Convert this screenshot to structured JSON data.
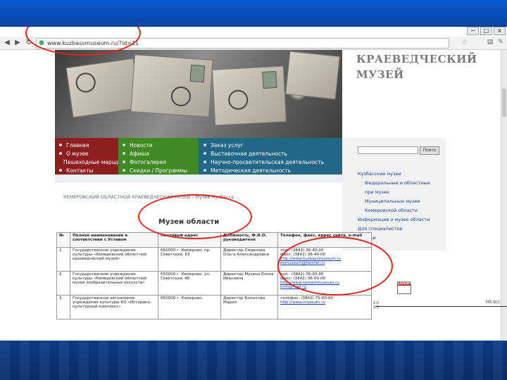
{
  "browser": {
    "url": "www.kuzbassmuseum.ru/?id=11",
    "window_controls": [
      "−",
      "□",
      "×"
    ],
    "nav_icons": [
      "back-icon",
      "forward-icon",
      "reload-icon"
    ],
    "toolbar_icons": [
      "page-icon",
      "wrench-icon"
    ]
  },
  "site": {
    "title_line1": "КРАЕВЕДЧЕСКИЙ",
    "title_line2": "МУЗЕЙ"
  },
  "menu": {
    "red": [
      "Главная",
      "О музее",
      "Пешеходные маршруты",
      "Контакты"
    ],
    "green": [
      "Новости",
      "Афиша",
      "Фотогалерея",
      "Скидки / Программы"
    ],
    "blue": [
      "Заказ услуг",
      "Выставочная деятельность",
      "Научно-просветительская деятельность",
      "Методическая деятельность"
    ]
  },
  "search": {
    "button": "Поиск"
  },
  "sidebar": {
    "links": [
      "Кузбасские музеи",
      "Федеральные и областные",
      "при музее",
      "Муниципальные музеи",
      "Кемеровской области",
      "Информация о музее области",
      "Для специалистов",
      "Ссылки"
    ]
  },
  "subtitle": "КЕМЕРОВСКИЙ ОБЛАСТНОЙ КРАЕВЕДЧЕСКИЙ МУЗЕЙ – Музеи Кузбасса",
  "heading": "Музеи области",
  "table": {
    "headers": [
      "№",
      "Полное наименование в соответствии с Уставом",
      "Почтовый адрес",
      "Должность, Ф.И.О. руководителя",
      "Телефон, факс, адрес сайта, e-mail"
    ],
    "rows": [
      {
        "num": "1.",
        "name": "Государственное учреждение культуры «Кемеровский областной краеведческий музей»",
        "address": "650000 г. Кемерово, пр. Советский, 63",
        "head": "Директор Смирнова Ольга Александровна",
        "phone": "тел.: (3842) 36-40-00",
        "fax": "факс: (3842) 36-40-00",
        "site": "http://www.kuzbassmuseum.ru",
        "email": "komuseum@kemtel.ru"
      },
      {
        "num": "2.",
        "name": "Государственное учреждение культуры «Кемеровский областной музей изобразительных искусств»",
        "address": "650000 г. Кемерово, ул. Советская, 48",
        "head": "Директор Мусина Елена Ивановна",
        "phone": "тел.: (3842) 36-00-00",
        "fax": "факс: (3842) 36-00-00",
        "site": "http://www.kemartmuseum.ru",
        "email": "kmii@mail.ru"
      },
      {
        "num": "3.",
        "name": "Государственное автономное учреждение культуры КО «Историко-культурный комплекс»",
        "address": "650000 г. Кемерово,",
        "head": "Директор Копытова Мария",
        "phone": "телефон: (3842) 75-00-00",
        "fax": "",
        "site": "http://www.museum.ru",
        "email": ""
      }
    ]
  },
  "counter": {
    "label": "LIVEINTERNET",
    "values": [
      "2.0",
      "1.5"
    ]
  },
  "right_label": "Hit-tcc",
  "colors": {
    "menu_red": "#8e1f21",
    "menu_green": "#3f8a24",
    "menu_blue": "#236788",
    "annotation": "#e2231a"
  }
}
